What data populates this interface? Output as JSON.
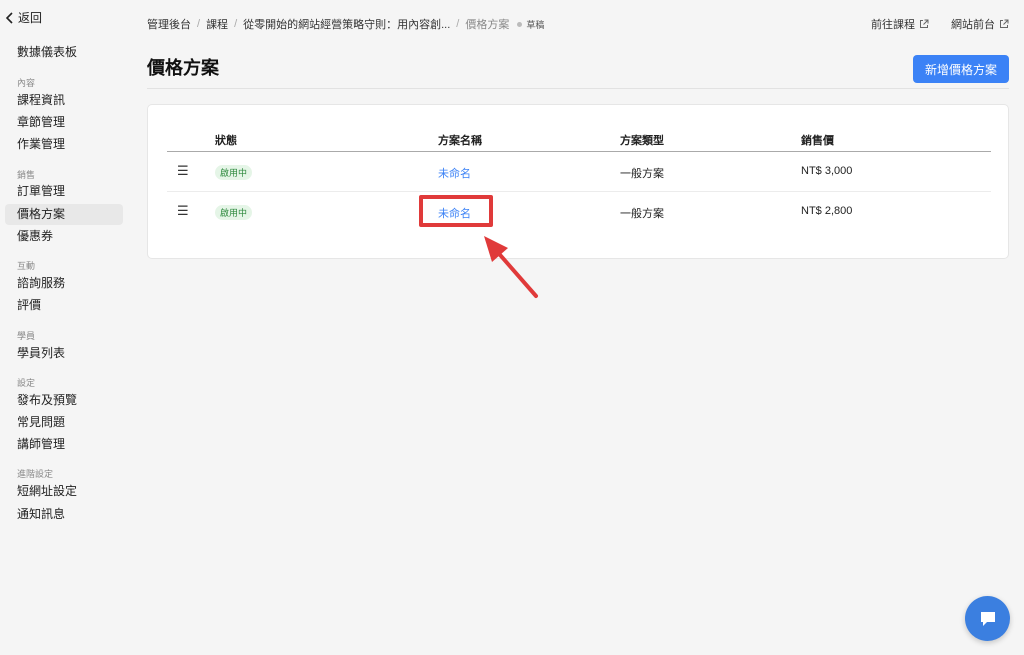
{
  "sidebar": {
    "back_label": "返回",
    "dashboard": "數據儀表板",
    "groups": {
      "content": "內容",
      "sales": "銷售",
      "interaction": "互動",
      "students": "學員",
      "settings": "設定",
      "advanced": "進階設定"
    },
    "items": {
      "course_info": "課程資訊",
      "chapters": "章節管理",
      "assignments": "作業管理",
      "orders": "訂單管理",
      "pricing": "價格方案",
      "coupons": "優惠券",
      "consulting": "諮詢服務",
      "reviews": "評價",
      "student_list": "學員列表",
      "publish": "發布及預覽",
      "faq": "常見問題",
      "instructors": "講師管理",
      "short_url": "短網址設定",
      "notifications": "通知訊息"
    }
  },
  "breadcrumb": {
    "admin": "管理後台",
    "courses": "課程",
    "course_name": "從零開始的網站經營策略守則：用內容創...",
    "current": "價格方案",
    "status": "草稿"
  },
  "top_links": {
    "goto_course": "前往課程",
    "site_front": "網站前台"
  },
  "page": {
    "title": "價格方案",
    "add_button": "新增價格方案"
  },
  "table": {
    "headers": [
      "狀態",
      "方案名稱",
      "方案類型",
      "銷售價"
    ],
    "rows": [
      {
        "status": "啟用中",
        "name": "未命名",
        "type": "一般方案",
        "price": "NT$ 3,000"
      },
      {
        "status": "啟用中",
        "name": "未命名",
        "type": "一般方案",
        "price": "NT$ 2,800"
      }
    ]
  },
  "colors": {
    "primary": "#3b82f6",
    "badge_green": "#2f8a3f",
    "highlight_red": "#e03a3a"
  },
  "icons": {
    "back": "chevron-left-icon",
    "external": "external-link-icon",
    "drag": "drag-handle-icon",
    "chat": "chat-icon"
  }
}
